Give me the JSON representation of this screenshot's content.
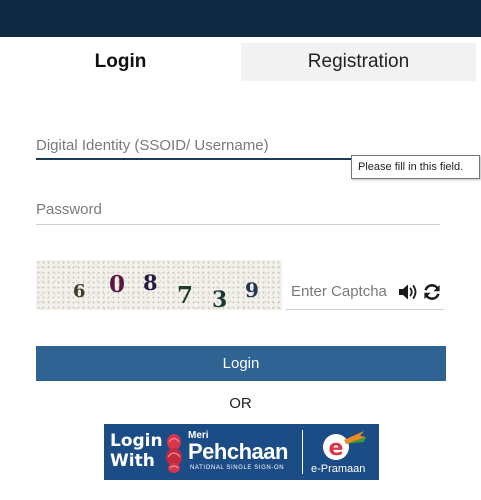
{
  "tabs": {
    "login": "Login",
    "registration": "Registration"
  },
  "form": {
    "ssoid_placeholder": "Digital Identity (SSOID/ Username)",
    "password_placeholder": "Password",
    "captcha_placeholder": "Enter Captcha",
    "validation_tooltip": "Please fill in this field.",
    "login_button": "Login",
    "or_text": "OR"
  },
  "captcha": {
    "digits": [
      "6",
      "0",
      "8",
      "7",
      "3",
      "9"
    ],
    "colors": [
      "#3f3b2a",
      "#5a1540",
      "#241b40",
      "#1d3a2a",
      "#163a36",
      "#1f3553"
    ]
  },
  "banner": {
    "login_with_line1": "Login",
    "login_with_line2": "With",
    "meri": "Meri",
    "pehchaan": "Pehchaan",
    "tagline": "NATIONAL SINGLE SIGN-ON",
    "epramaan": "e-Pramaan"
  },
  "icons": {
    "audio": "speaker-icon",
    "refresh": "refresh-icon"
  },
  "colors": {
    "topbar": "#0d2a42",
    "primary_button": "#2f6393",
    "banner": "#1b4c86"
  }
}
